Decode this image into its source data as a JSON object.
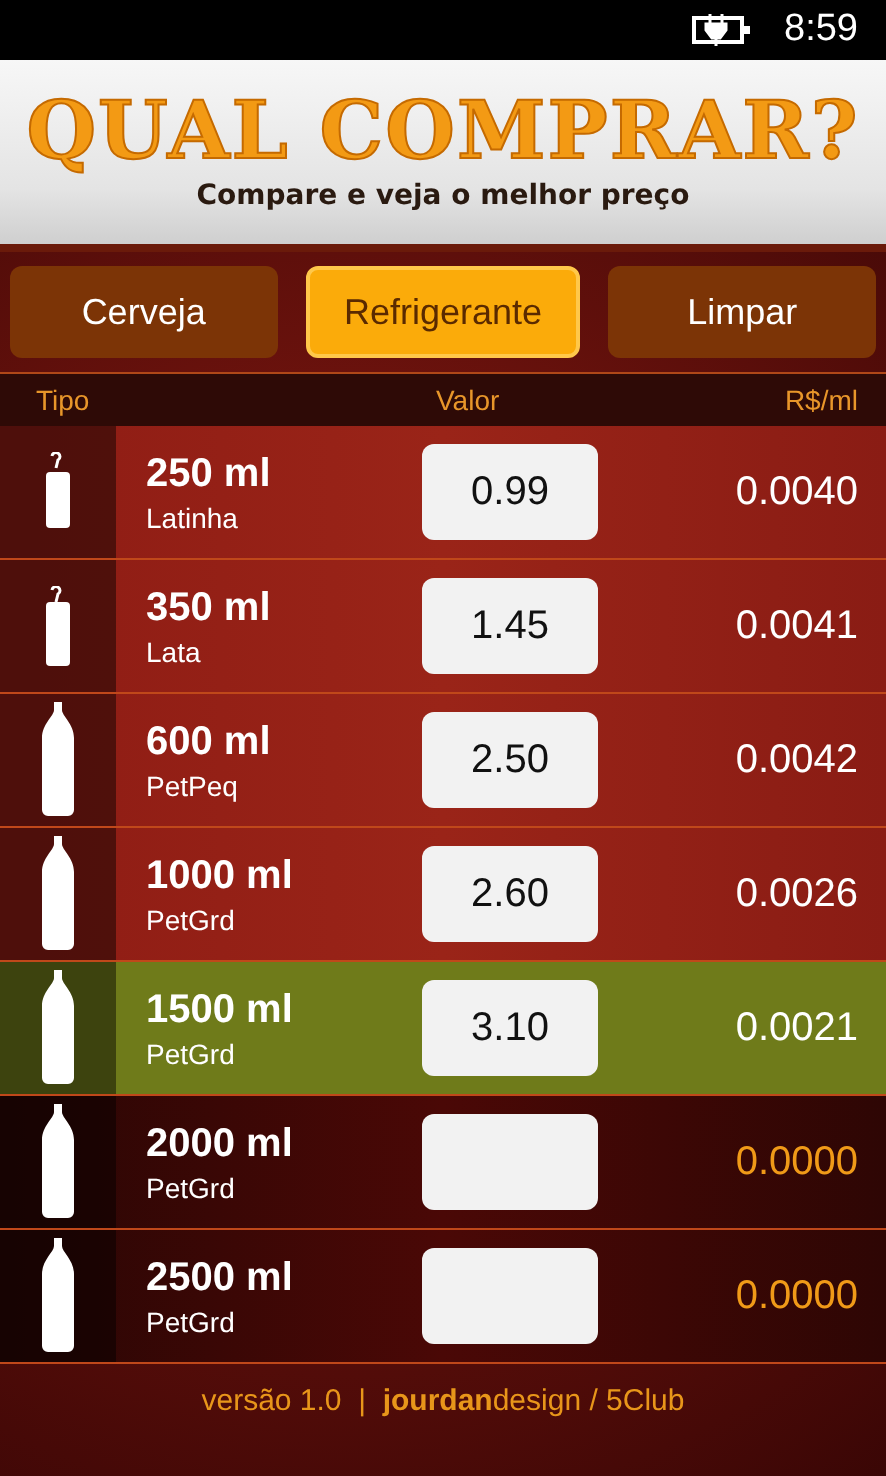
{
  "status_bar": {
    "time": "8:59"
  },
  "header": {
    "title": "QUAL COMPRAR?",
    "subtitle": "Compare e veja o melhor preço"
  },
  "buttons": [
    {
      "label": "Cerveja",
      "selected": false
    },
    {
      "label": "Refrigerante",
      "selected": true
    },
    {
      "label": "Limpar",
      "selected": false
    }
  ],
  "table": {
    "columns": [
      "Tipo",
      "Valor",
      "R$/ml"
    ],
    "rows": [
      {
        "kind": "can",
        "size": "250 ml",
        "name": "Latinha",
        "value": "0.99",
        "ratio": "0.0040",
        "best": false
      },
      {
        "kind": "can",
        "size": "350 ml",
        "name": "Lata",
        "value": "1.45",
        "ratio": "0.0041",
        "best": false
      },
      {
        "kind": "bottle",
        "size": "600 ml",
        "name": "PetPeq",
        "value": "2.50",
        "ratio": "0.0042",
        "best": false
      },
      {
        "kind": "bottle",
        "size": "1000 ml",
        "name": "PetGrd",
        "value": "2.60",
        "ratio": "0.0026",
        "best": false
      },
      {
        "kind": "bottle",
        "size": "1500 ml",
        "name": "PetGrd",
        "value": "3.10",
        "ratio": "0.0021",
        "best": true
      },
      {
        "kind": "bottle",
        "size": "2000 ml",
        "name": "PetGrd",
        "ratio": "0.0000",
        "best": false
      },
      {
        "kind": "bottle",
        "size": "2500 ml",
        "name": "PetGrd",
        "ratio": "0.0000",
        "best": false
      }
    ]
  },
  "footer": "versão 1.0  |  **jourdan**design / 5Club"
}
